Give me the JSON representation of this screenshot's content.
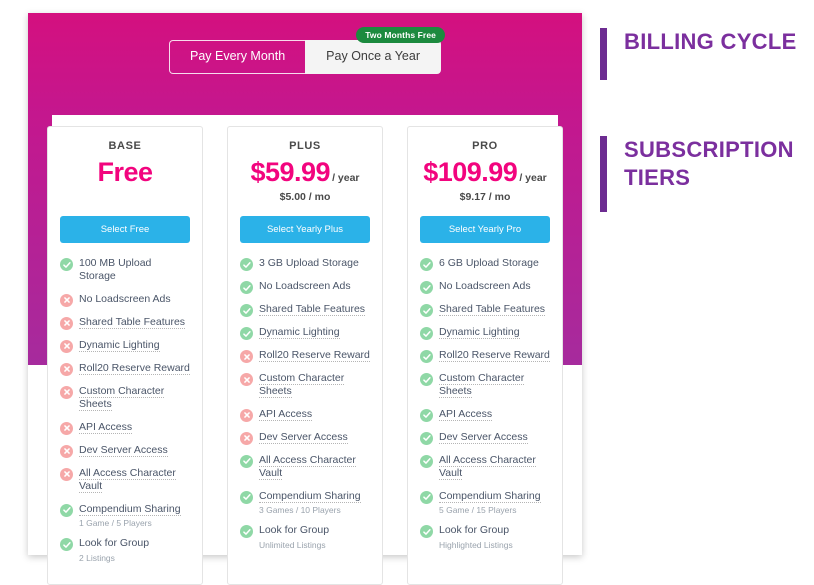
{
  "billing_toggle": {
    "monthly_label": "Pay Every Month",
    "yearly_label": "Pay Once a Year",
    "badge_label": "Two Months Free",
    "selected": "Pay Once a Year"
  },
  "colors": {
    "panel_pink": "#c4178e",
    "price_pink": "#f2047e",
    "button_blue": "#2bb2e8",
    "badge_green": "#1c8a3e",
    "annotation_purple": "#7b2f9e",
    "yes_green": "#8fd8a6",
    "no_red": "#f6a8a8"
  },
  "annotations": [
    {
      "id": "billing-cycle",
      "text": "BILLING CYCLE"
    },
    {
      "id": "subscription-tiers",
      "text": "SUBSCRIPTION TIERS"
    }
  ],
  "tiers": [
    {
      "name": "BASE",
      "price": "Free",
      "price_period": "",
      "price_sub": "",
      "cta": "Select Free",
      "features": [
        {
          "label": "100 MB Upload Storage",
          "state": "yes",
          "hint": false,
          "sub": ""
        },
        {
          "label": "No Loadscreen Ads",
          "state": "no",
          "hint": false,
          "sub": ""
        },
        {
          "label": "Shared Table Features",
          "state": "no",
          "hint": true,
          "sub": ""
        },
        {
          "label": "Dynamic Lighting",
          "state": "no",
          "hint": true,
          "sub": ""
        },
        {
          "label": "Roll20 Reserve Reward",
          "state": "no",
          "hint": true,
          "sub": ""
        },
        {
          "label": "Custom Character Sheets",
          "state": "no",
          "hint": true,
          "sub": ""
        },
        {
          "label": "API Access",
          "state": "no",
          "hint": true,
          "sub": ""
        },
        {
          "label": "Dev Server Access",
          "state": "no",
          "hint": true,
          "sub": ""
        },
        {
          "label": "All Access Character Vault",
          "state": "no",
          "hint": true,
          "sub": ""
        },
        {
          "label": "Compendium Sharing",
          "state": "yes",
          "hint": true,
          "sub": "1 Game / 5 Players"
        },
        {
          "label": "Look for Group",
          "state": "yes",
          "hint": false,
          "sub": "2 Listings"
        }
      ]
    },
    {
      "name": "PLUS",
      "price": "$59.99",
      "price_period": "/ year",
      "price_sub": "$5.00 / mo",
      "cta": "Select Yearly Plus",
      "features": [
        {
          "label": "3 GB Upload Storage",
          "state": "yes",
          "hint": false,
          "sub": ""
        },
        {
          "label": "No Loadscreen Ads",
          "state": "yes",
          "hint": false,
          "sub": ""
        },
        {
          "label": "Shared Table Features",
          "state": "yes",
          "hint": true,
          "sub": ""
        },
        {
          "label": "Dynamic Lighting",
          "state": "yes",
          "hint": true,
          "sub": ""
        },
        {
          "label": "Roll20 Reserve Reward",
          "state": "no",
          "hint": true,
          "sub": ""
        },
        {
          "label": "Custom Character Sheets",
          "state": "no",
          "hint": true,
          "sub": ""
        },
        {
          "label": "API Access",
          "state": "no",
          "hint": true,
          "sub": ""
        },
        {
          "label": "Dev Server Access",
          "state": "no",
          "hint": true,
          "sub": ""
        },
        {
          "label": "All Access Character Vault",
          "state": "yes",
          "hint": true,
          "sub": ""
        },
        {
          "label": "Compendium Sharing",
          "state": "yes",
          "hint": true,
          "sub": "3 Games / 10 Players"
        },
        {
          "label": "Look for Group",
          "state": "yes",
          "hint": false,
          "sub": "Unlimited Listings"
        }
      ]
    },
    {
      "name": "PRO",
      "price": "$109.99",
      "price_period": "/ year",
      "price_sub": "$9.17 / mo",
      "cta": "Select Yearly Pro",
      "features": [
        {
          "label": "6 GB Upload Storage",
          "state": "yes",
          "hint": false,
          "sub": ""
        },
        {
          "label": "No Loadscreen Ads",
          "state": "yes",
          "hint": false,
          "sub": ""
        },
        {
          "label": "Shared Table Features",
          "state": "yes",
          "hint": true,
          "sub": ""
        },
        {
          "label": "Dynamic Lighting",
          "state": "yes",
          "hint": true,
          "sub": ""
        },
        {
          "label": "Roll20 Reserve Reward",
          "state": "yes",
          "hint": true,
          "sub": ""
        },
        {
          "label": "Custom Character Sheets",
          "state": "yes",
          "hint": true,
          "sub": ""
        },
        {
          "label": "API Access",
          "state": "yes",
          "hint": true,
          "sub": ""
        },
        {
          "label": "Dev Server Access",
          "state": "yes",
          "hint": true,
          "sub": ""
        },
        {
          "label": "All Access Character Vault",
          "state": "yes",
          "hint": true,
          "sub": ""
        },
        {
          "label": "Compendium Sharing",
          "state": "yes",
          "hint": true,
          "sub": "5 Game / 15 Players"
        },
        {
          "label": "Look for Group",
          "state": "yes",
          "hint": false,
          "sub": "Highlighted Listings"
        }
      ]
    }
  ]
}
